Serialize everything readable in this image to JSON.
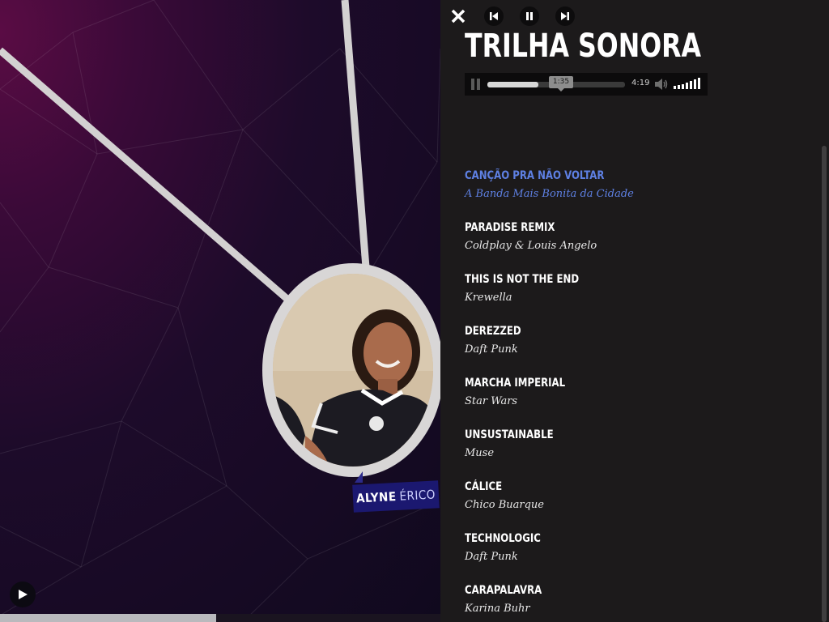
{
  "background": {
    "person_name_first": "ALYNE",
    "person_name_last": "ÉRICO",
    "bottom_progress_fraction": 0.49
  },
  "panel": {
    "title": "TRILHA SONORA",
    "controls": {
      "close": "close-icon",
      "previous": "skip-previous-icon",
      "pause": "pause-icon",
      "next": "skip-next-icon"
    },
    "audio_player": {
      "current_time": "1:35",
      "duration": "4:19",
      "progress_fraction": 0.37
    },
    "tracks": [
      {
        "title": "CANÇÃO PRA NÃO VOLTAR",
        "artist": "A Banda Mais Bonita da Cidade",
        "active": true
      },
      {
        "title": "PARADISE REMIX",
        "artist": "Coldplay & Louis Angelo",
        "active": false
      },
      {
        "title": "THIS IS NOT THE END",
        "artist": "Krewella",
        "active": false
      },
      {
        "title": "DEREZZED",
        "artist": "Daft Punk",
        "active": false
      },
      {
        "title": "MARCHA IMPERIAL",
        "artist": "Star Wars",
        "active": false
      },
      {
        "title": "UNSUSTAINABLE",
        "artist": "Muse",
        "active": false
      },
      {
        "title": "CÁLICE",
        "artist": "Chico Buarque",
        "active": false
      },
      {
        "title": "TECHNOLOGIC",
        "artist": "Daft Punk",
        "active": false
      },
      {
        "title": "CARAPALAVRA",
        "artist": "Karina Buhr",
        "active": false
      }
    ]
  },
  "colors": {
    "panel_bg": "#1c1a1b",
    "active_track": "#5e80e3",
    "name_tag": "#1b1870",
    "connector_lines": "#d8d6d6"
  }
}
